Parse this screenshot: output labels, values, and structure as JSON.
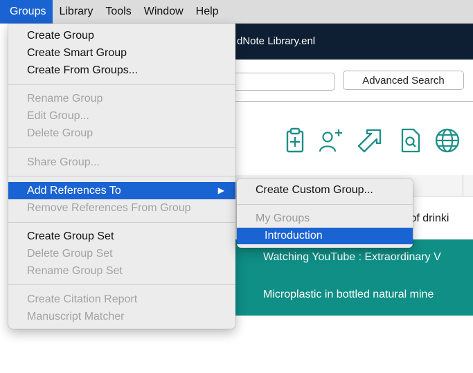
{
  "menubar": {
    "items": [
      "Groups",
      "Library",
      "Tools",
      "Window",
      "Help"
    ]
  },
  "window": {
    "title": "dNote Library.enl",
    "advanced_search_label": "Advanced Search",
    "toolbar_icons": [
      "new-reference-icon",
      "add-author-icon",
      "share-arrow-icon",
      "find-pdf-icon",
      "online-search-globe-icon"
    ]
  },
  "references": {
    "rows": [
      "s of drinki",
      "Watching YouTube : Extraordinary V",
      "Microplastic in bottled natural mine"
    ]
  },
  "groups_menu": {
    "create_group": "Create Group",
    "create_smart_group": "Create Smart Group",
    "create_from_groups": "Create From Groups...",
    "rename_group": "Rename Group",
    "edit_group": "Edit Group...",
    "delete_group": "Delete Group",
    "share_group": "Share Group...",
    "add_references_to": "Add References To",
    "remove_references": "Remove References From Group",
    "create_group_set": "Create Group Set",
    "delete_group_set": "Delete Group Set",
    "rename_group_set": "Rename Group Set",
    "create_citation_report": "Create Citation Report",
    "manuscript_matcher": "Manuscript Matcher"
  },
  "submenu": {
    "create_custom_group": "Create Custom Group...",
    "my_groups_header": "My Groups",
    "introduction": "Introduction"
  },
  "colors": {
    "menu_highlight": "#1a63d2",
    "titlebar": "#0f1f33",
    "selected_row": "#0f8f86",
    "toolbar_icon": "#1b8f87"
  }
}
